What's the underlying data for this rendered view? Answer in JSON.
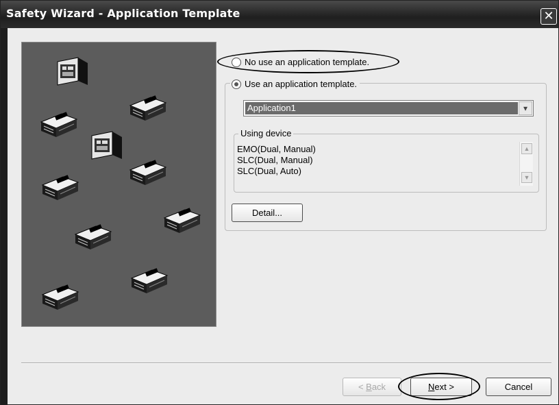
{
  "window": {
    "title": "Safety Wizard - Application Template",
    "close_glyph": "✕"
  },
  "options": {
    "no_template_label": "No use an application template.",
    "use_template_label": "Use an application template.",
    "selected_option": "use_template"
  },
  "template_select": {
    "value": "Application1",
    "arrow": "▾"
  },
  "using_device": {
    "legend": "Using device",
    "items": [
      "EMO(Dual, Manual)",
      "SLC(Dual, Manual)",
      "SLC(Dual, Auto)"
    ]
  },
  "buttons": {
    "detail": "Detail...",
    "back_hotkey": "B",
    "back_rest": "ack",
    "back_prefix": "< ",
    "next_hotkey": "N",
    "next_rest": "ext >",
    "cancel": "Cancel"
  },
  "scroll": {
    "up": "▲",
    "down": "▼"
  },
  "colors": {
    "titlebar": "#2b2b2b",
    "panel_bg": "#5c5c5c",
    "selection": "#6b6b6b"
  }
}
